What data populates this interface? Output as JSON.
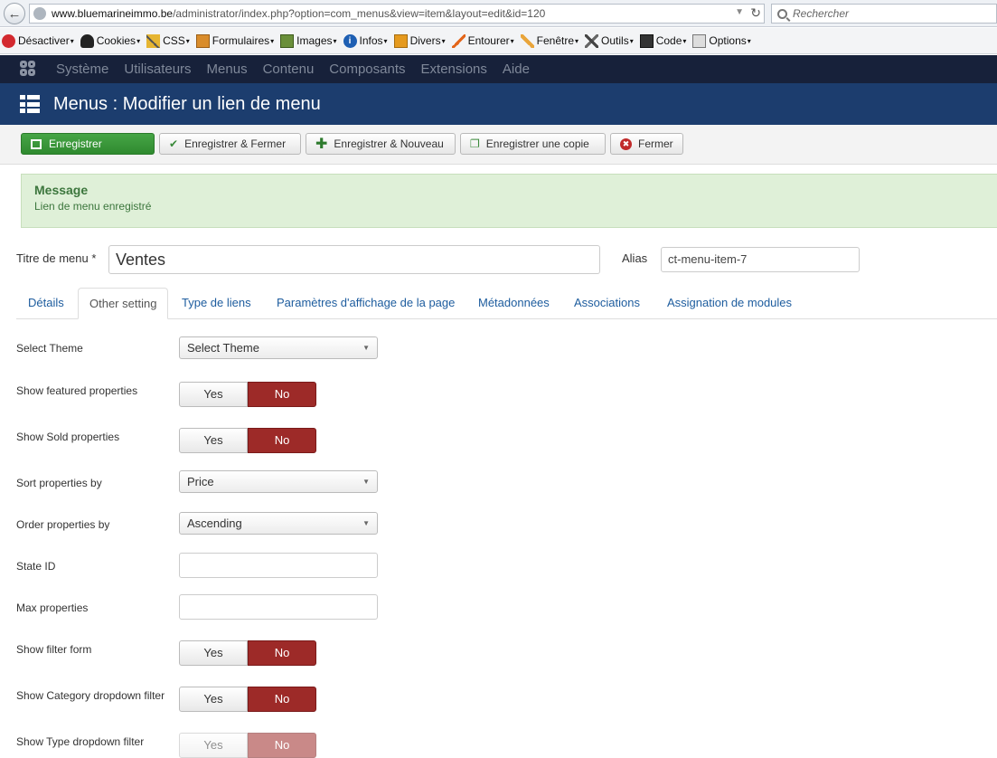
{
  "browser": {
    "url_domain": "www.bluemarineimmo.be",
    "url_path": "/administrator/index.php?option=com_menus&view=item&layout=edit&id=120",
    "search_placeholder": "Rechercher"
  },
  "devtoolbar": {
    "items": [
      "Désactiver",
      "Cookies",
      "CSS",
      "Formulaires",
      "Images",
      "Infos",
      "Divers",
      "Entourer",
      "Fenêtre",
      "Outils",
      "Code",
      "Options"
    ]
  },
  "nav": {
    "items": [
      "Système",
      "Utilisateurs",
      "Menus",
      "Contenu",
      "Composants",
      "Extensions",
      "Aide"
    ]
  },
  "header": {
    "title": "Menus : Modifier un lien de menu"
  },
  "toolbar": {
    "save": "Enregistrer",
    "save_close": "Enregistrer & Fermer",
    "save_new": "Enregistrer & Nouveau",
    "save_copy": "Enregistrer une copie",
    "close": "Fermer"
  },
  "message": {
    "title": "Message",
    "text": "Lien de menu enregistré"
  },
  "title_row": {
    "title_label": "Titre de menu *",
    "title_value": "Ventes",
    "alias_label": "Alias",
    "alias_value": "ct-menu-item-7"
  },
  "tabs": [
    "Détails",
    "Other setting",
    "Type de liens",
    "Paramètres d'affichage de la page",
    "Métadonnées",
    "Associations",
    "Assignation de modules"
  ],
  "active_tab": "Other setting",
  "form": {
    "select_theme_label": "Select Theme",
    "select_theme_value": "Select Theme",
    "featured_label": "Show featured properties",
    "sold_label": "Show Sold properties",
    "sort_label": "Sort properties by",
    "sort_value": "Price",
    "order_label": "Order properties by",
    "order_value": "Ascending",
    "state_label": "State ID",
    "max_label": "Max properties",
    "filter_label": "Show filter form",
    "category_label": "Show Category dropdown filter",
    "type_label": "Show Type dropdown filter",
    "yes": "Yes",
    "no": "No"
  },
  "colors": {
    "navbar": "#17213a",
    "header": "#1c3d6e",
    "primary": "#46a546",
    "no_active": "#9d2a28",
    "message_bg": "#dff0d8"
  }
}
